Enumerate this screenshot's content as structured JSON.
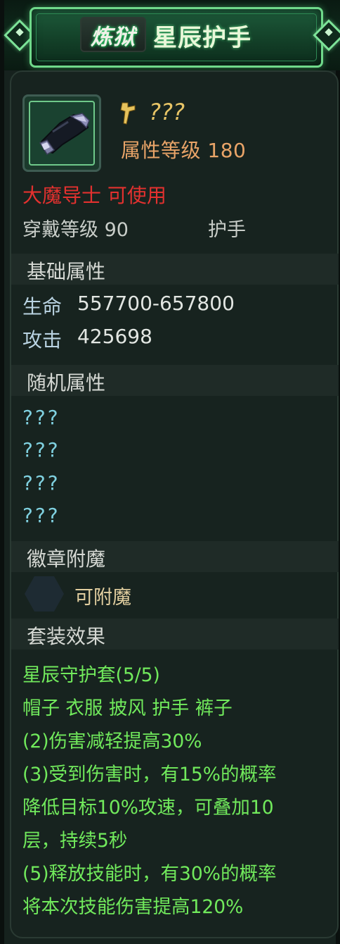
{
  "header": {
    "tier": "炼狱",
    "item_name": "星辰护手"
  },
  "item": {
    "icon": "gauntlet-icon",
    "type_icon": "sword-icon",
    "name_hidden": "???",
    "attribute_level": "属性等级 180",
    "class_requirement": "大魔导士 可使用",
    "wear_level": "穿戴等级 90",
    "slot": "护手"
  },
  "basic_attributes": {
    "title": "基础属性",
    "stats": [
      {
        "label": "生命",
        "value": "557700-657800"
      },
      {
        "label": "攻击",
        "value": "425698"
      }
    ]
  },
  "random_attributes": {
    "title": "随机属性",
    "lines": [
      "???",
      "???",
      "???",
      "???"
    ]
  },
  "badge_enchant": {
    "title": "徽章附魔",
    "icon": "hexagon-badge-icon",
    "status": "可附魔"
  },
  "set_effect": {
    "title": "套装效果",
    "lines": [
      "星辰守护套(5/5)",
      "帽子 衣服 披风 护手 裤子",
      "(2)伤害减轻提高30%",
      "(3)受到伤害时，有15%的概率",
      "降低目标10%攻速，可叠加10",
      "层，持续5秒",
      "(5)释放技能时，有30%的概率",
      "将本次技能伤害提高120%"
    ]
  },
  "colors": {
    "accent_green": "#6fd98a",
    "class_red": "#e3312f",
    "set_green": "#71ea5c",
    "unknown_gold": "#e7c466",
    "attr_orange": "#e9a468"
  }
}
